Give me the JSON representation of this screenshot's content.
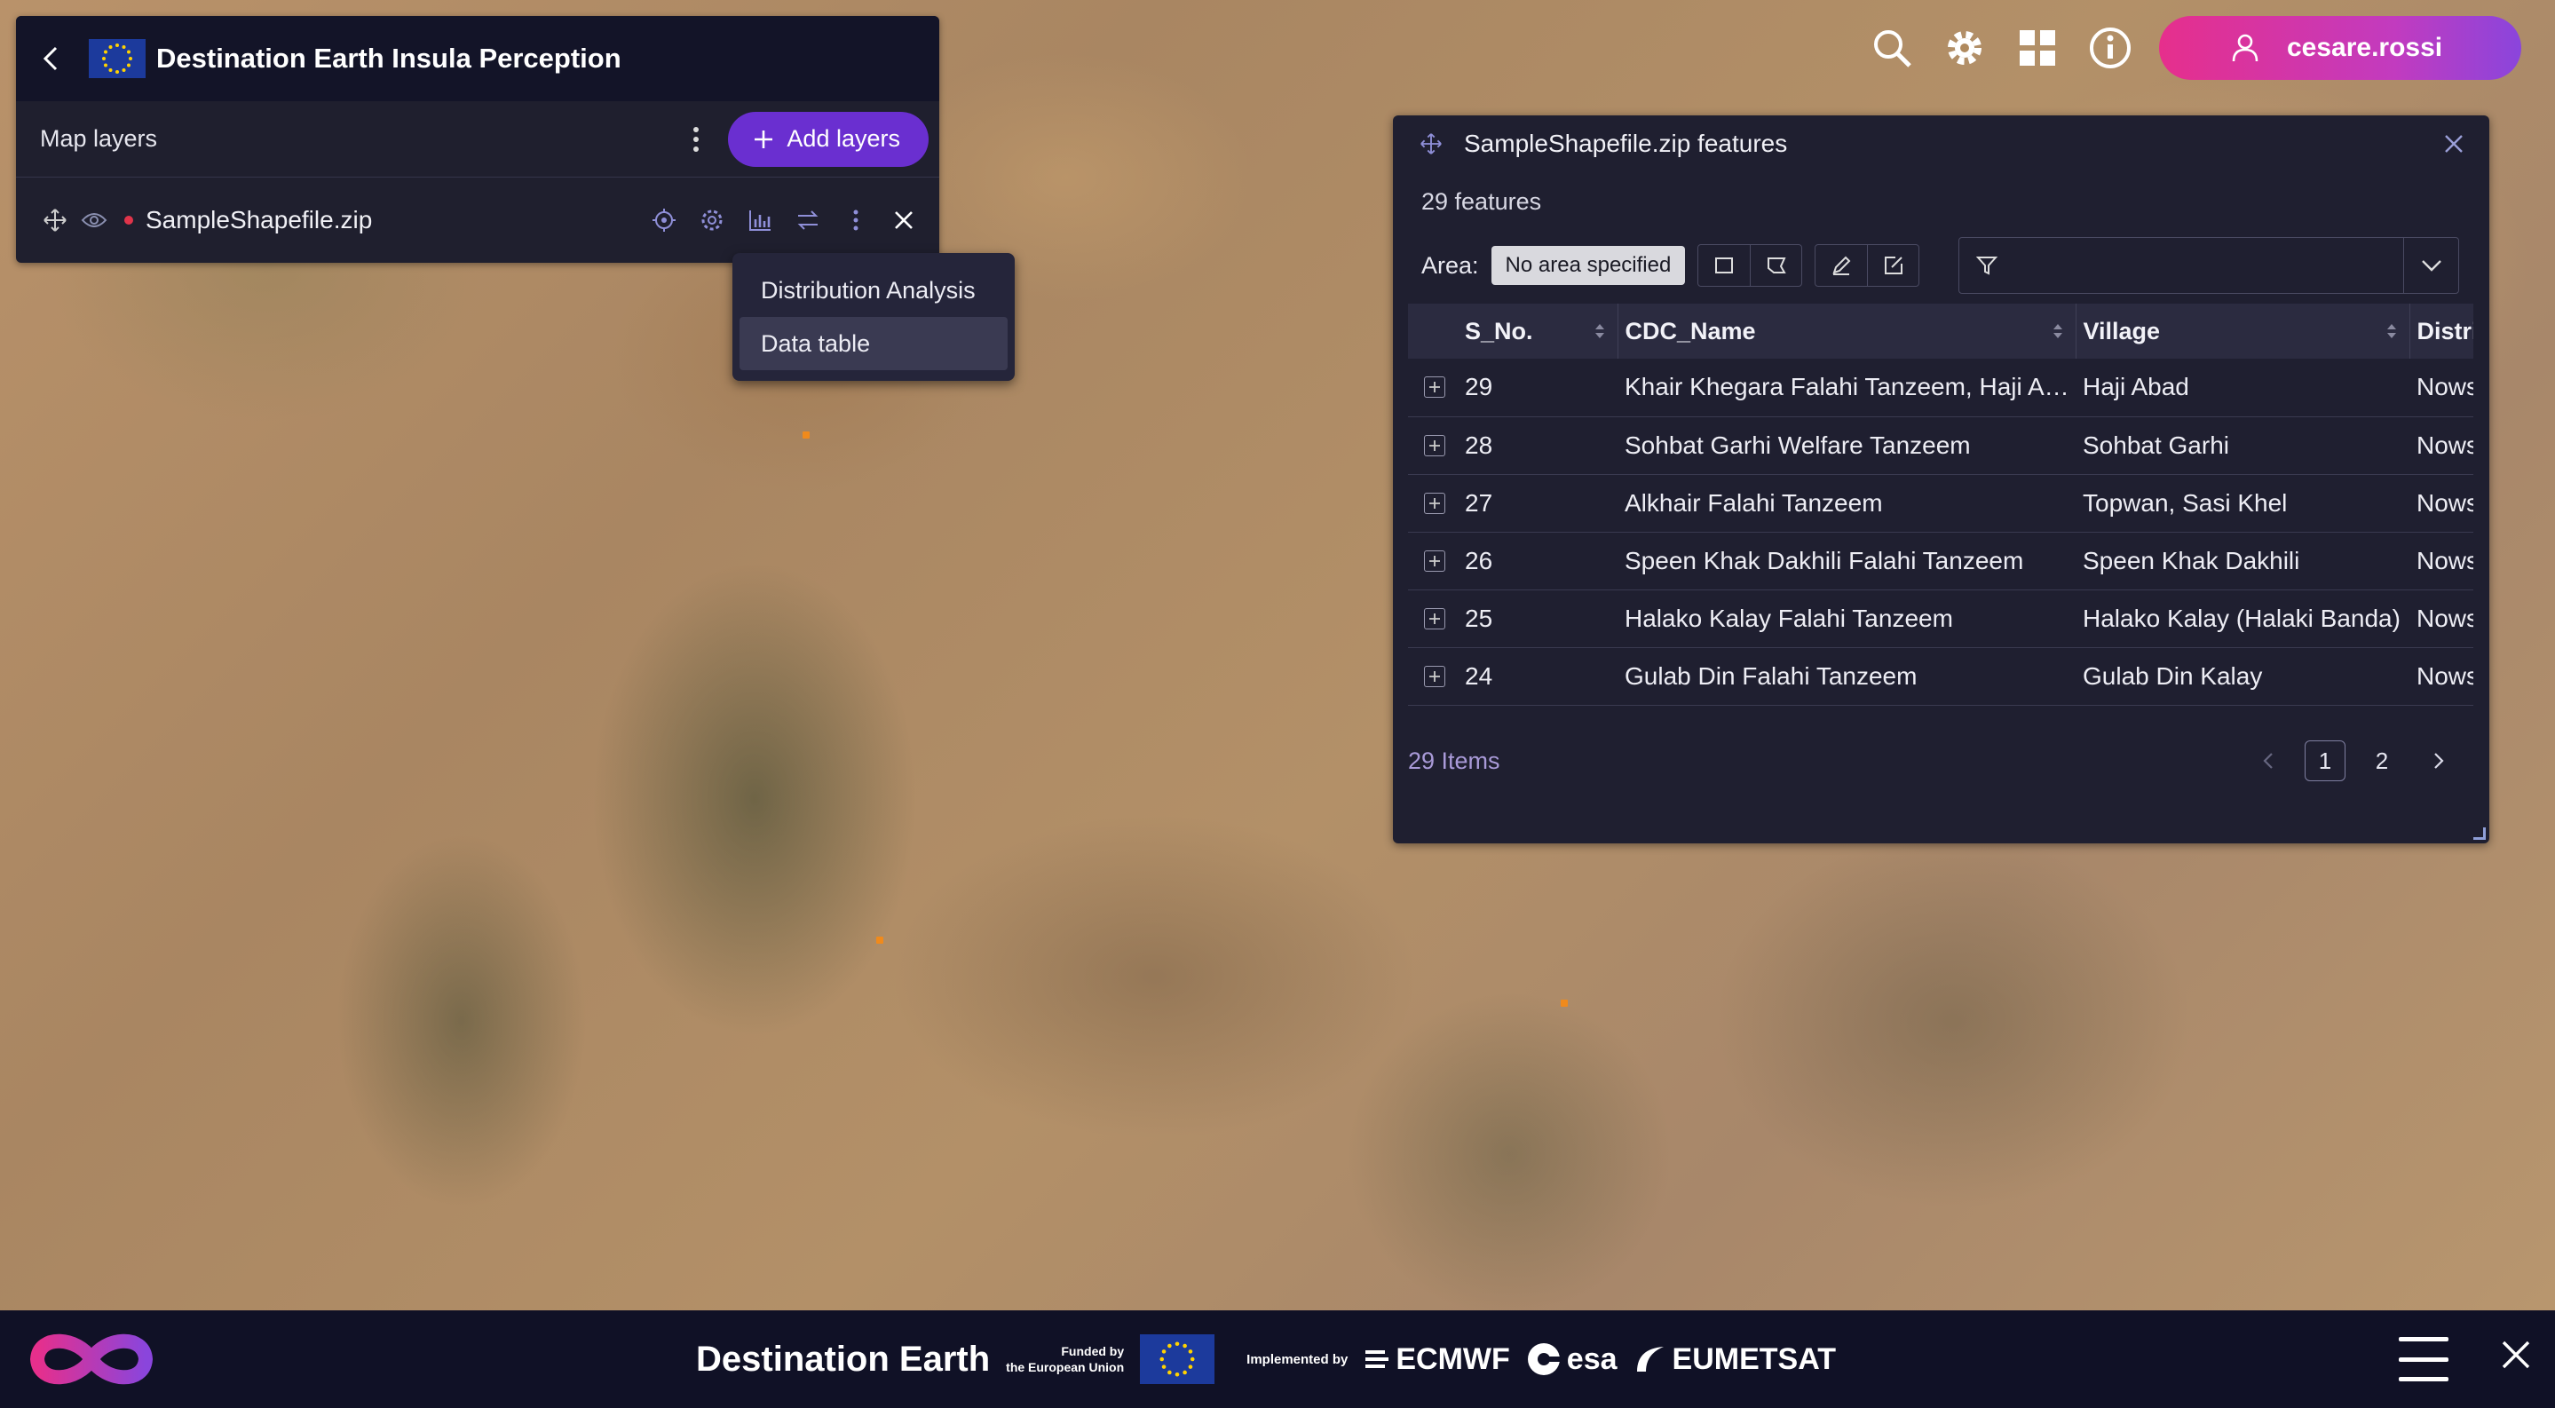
{
  "app": {
    "title": "Destination Earth Insula Perception"
  },
  "layers_panel": {
    "title": "Map layers",
    "add_label": "Add layers",
    "layer": {
      "name": "SampleShapefile.zip",
      "color": "#e0344a"
    }
  },
  "dropdown": {
    "items": [
      "Distribution Analysis",
      "Data table"
    ],
    "active": "Data table"
  },
  "user": {
    "name": "cesare.rossi"
  },
  "features": {
    "title": "SampleShapefile.zip features",
    "count_label": "29 features",
    "area_label": "Area:",
    "area_value": "No area specified",
    "filter_placeholder": "",
    "columns": [
      "S_No.",
      "CDC_Name",
      "Village",
      "Distric"
    ],
    "rows": [
      {
        "s_no": "29",
        "cdc_name": "Khair Khegara Falahi Tanzeem, Haji Ab...",
        "village": "Haji Abad",
        "district": "Nowshera"
      },
      {
        "s_no": "28",
        "cdc_name": "Sohbat Garhi Welfare Tanzeem",
        "village": "Sohbat Garhi",
        "district": "Nowshera"
      },
      {
        "s_no": "27",
        "cdc_name": "Alkhair Falahi Tanzeem",
        "village": "Topwan, Sasi Khel",
        "district": "Nowshera"
      },
      {
        "s_no": "26",
        "cdc_name": "Speen Khak Dakhili Falahi Tanzeem",
        "village": "Speen Khak Dakhili",
        "district": "Nowshera"
      },
      {
        "s_no": "25",
        "cdc_name": "Halako Kalay Falahi Tanzeem",
        "village": "Halako Kalay (Halaki Banda)",
        "district": "Nowshera"
      },
      {
        "s_no": "24",
        "cdc_name": "Gulab Din Falahi Tanzeem",
        "village": "Gulab Din Kalay",
        "district": "Nowshera"
      }
    ],
    "items_label": "29 Items",
    "pages": [
      "1",
      "2"
    ],
    "current_page": "1"
  },
  "footer": {
    "brand": "Destination Earth",
    "funded_line1": "Funded by",
    "funded_line2": "the European Union",
    "implemented": "Implemented by",
    "partners": [
      "ECMWF",
      "esa",
      "EUMETSAT"
    ]
  },
  "colors": {
    "accent": "#6a2fd0",
    "user_gradient_start": "#e62f8c",
    "user_gradient_end": "#8a45dc",
    "panel_bg": "#1f1f30",
    "feature_dot": "#f08a1c"
  }
}
